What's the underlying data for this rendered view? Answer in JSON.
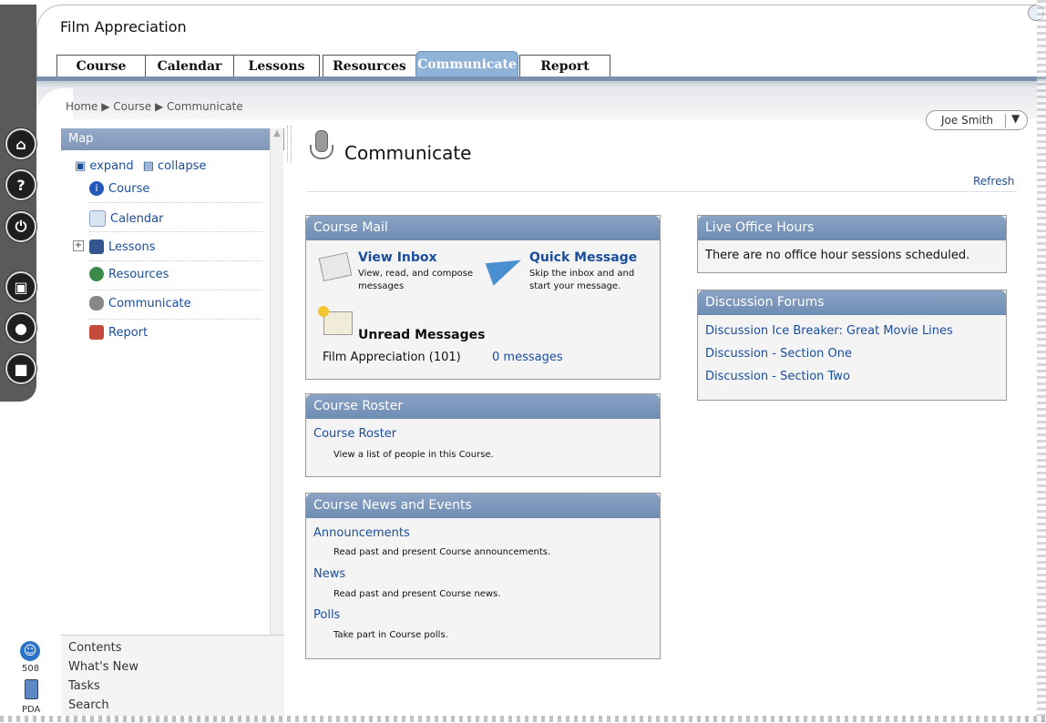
{
  "course_title": "Film Appreciation",
  "tabs": [
    "Course",
    "Calendar",
    "Lessons",
    "Resources",
    "Communicate",
    "Report"
  ],
  "active_tab": "Communicate",
  "breadcrumb": [
    "Home",
    "Course",
    "Communicate"
  ],
  "breadcrumb_text": "Home ▶ Course ▶ Communicate",
  "user": {
    "name": "Joe Smith",
    "menu_icon": "chevron-down-icon"
  },
  "rail_icons": [
    "home-icon",
    "help-icon",
    "power-icon",
    "briefcase-icon",
    "profile-icon",
    "chat-icon"
  ],
  "map": {
    "title": "Map",
    "expand": "expand",
    "collapse": "collapse",
    "items": [
      {
        "label": "Course",
        "icon": "info-icon"
      },
      {
        "label": "Calendar",
        "icon": "calendar-icon"
      },
      {
        "label": "Lessons",
        "icon": "book-icon"
      },
      {
        "label": "Resources",
        "icon": "globe-icon"
      },
      {
        "label": "Communicate",
        "icon": "microphone-icon"
      },
      {
        "label": "Report",
        "icon": "report-icon"
      }
    ],
    "bottom": [
      "Contents",
      "What's New",
      "Tasks",
      "Search"
    ]
  },
  "accessibility": {
    "label": "508"
  },
  "pda": {
    "label": "PDA"
  },
  "page": {
    "title": "Communicate",
    "refresh": "Refresh"
  },
  "course_mail": {
    "header": "Course Mail",
    "view_inbox": "View Inbox",
    "view_inbox_desc1": "View, read, and compose",
    "view_inbox_desc2": "messages",
    "quick_message": "Quick Message",
    "quick_message_desc1": "Skip the inbox and and",
    "quick_message_desc2": "start your message.",
    "unread_title": "Unread Messages",
    "unread_course": "Film Appreciation (101)",
    "unread_count": "0 messages"
  },
  "course_roster": {
    "header": "Course Roster",
    "link": "Course Roster",
    "desc": "View a list of people in this Course."
  },
  "news_events": {
    "header": "Course News and Events",
    "items": [
      {
        "label": "Announcements",
        "desc": "Read past and present Course announcements."
      },
      {
        "label": "News",
        "desc": "Read past and present Course news."
      },
      {
        "label": "Polls",
        "desc": "Take part in Course polls."
      }
    ]
  },
  "office_hours": {
    "header": "Live Office Hours",
    "message": "There are no office hour sessions scheduled."
  },
  "forums": {
    "header": "Discussion Forums",
    "items": [
      "Discussion Ice Breaker: Great Movie Lines",
      "Discussion - Section One",
      "Discussion - Section Two"
    ]
  }
}
